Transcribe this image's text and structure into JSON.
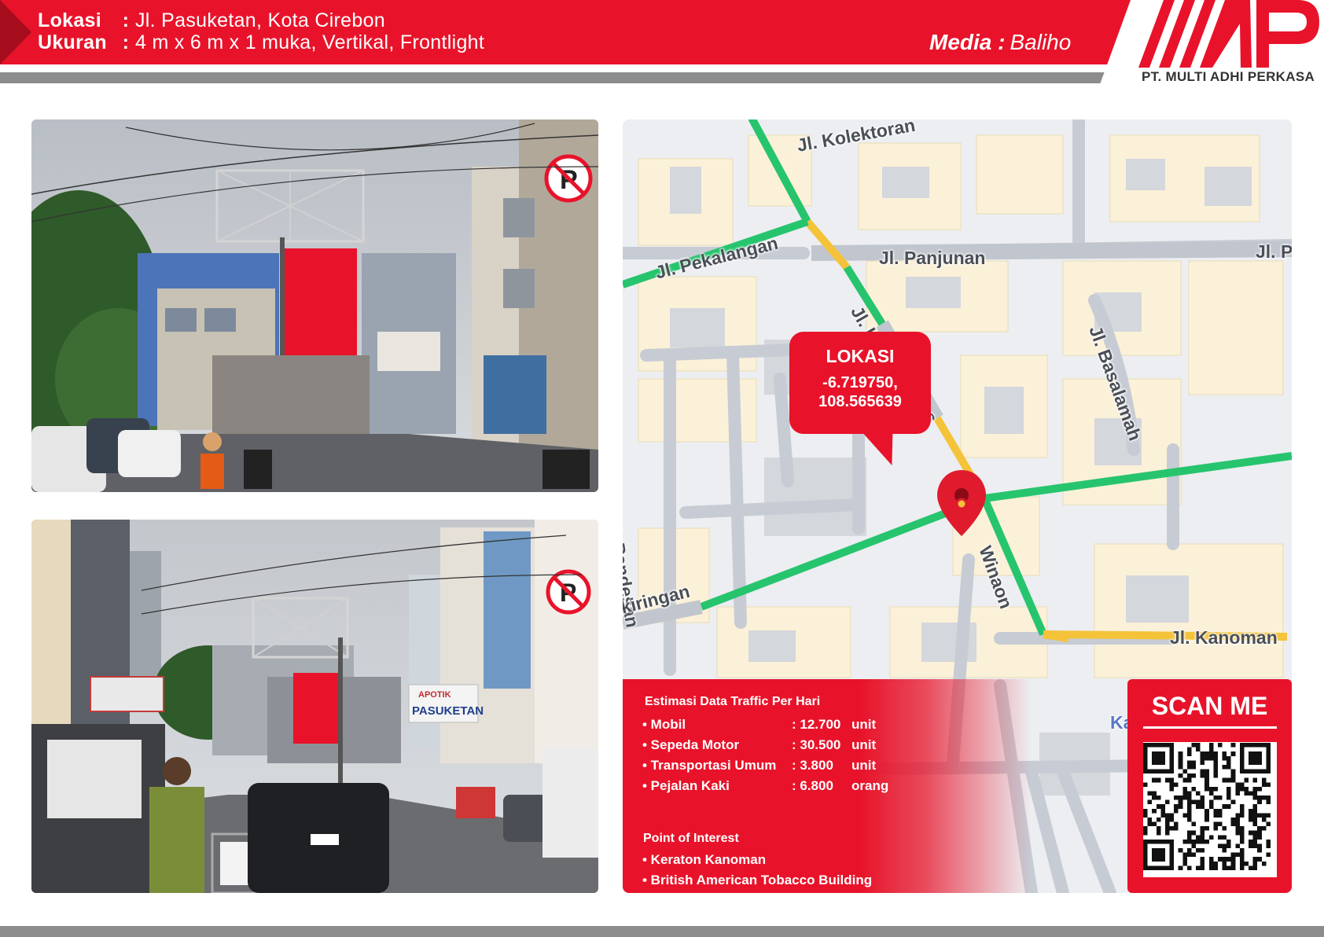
{
  "header": {
    "lokasi_label": "Lokasi",
    "lokasi_value": "Jl. Pasuketan, Kota Cirebon",
    "ukuran_label": "Ukuran",
    "ukuran_value": "4 m x 6 m x 1 muka, Vertikal, Frontlight",
    "separator": ":",
    "media_label": "Media :",
    "media_value": "Baliho"
  },
  "brand": {
    "logo_text": "MAP",
    "company": "PT. MULTI ADHI PERKASA",
    "color": "#e8132a"
  },
  "photos": [
    {
      "name": "street-photo-1",
      "sign_text": ""
    },
    {
      "name": "street-photo-2",
      "sign_text": "APOTIK",
      "sign_text_2": "PASUKETAN"
    }
  ],
  "map": {
    "streets": {
      "kolektoran": "Jl. Kolektoran",
      "pekalangan": "Jl. Pekalangan",
      "panjunan": "Jl. Panjunan",
      "jl_p": "Jl. P",
      "basalamah": "Jl. Basalamah",
      "jl_k": "Jl. K",
      "s": "s",
      "pandesan": "Jl. Pandesan",
      "kiringan": "kiringan",
      "winaon": "Winaon",
      "kanoman": "Jl. Kanoman",
      "ka": "Ka"
    },
    "callout": {
      "title": "LOKASI",
      "lat": "-6.719750,",
      "lng": "108.565639"
    }
  },
  "traffic": {
    "title": "Estimasi Data Traffic Per Hari",
    "rows": [
      {
        "label": "• Mobil",
        "value": ": 12.700",
        "unit": "unit"
      },
      {
        "label": "• Sepeda Motor",
        "value": ": 30.500",
        "unit": "unit"
      },
      {
        "label": "• Transportasi Umum",
        "value": ": 3.800",
        "unit": "unit"
      },
      {
        "label": "• Pejalan Kaki",
        "value": ": 6.800",
        "unit": "orang"
      }
    ],
    "poi_title": "Point of Interest",
    "poi": [
      "• Keraton Kanoman",
      "• British American Tobacco Building"
    ]
  },
  "scan": {
    "label": "SCAN ME"
  }
}
